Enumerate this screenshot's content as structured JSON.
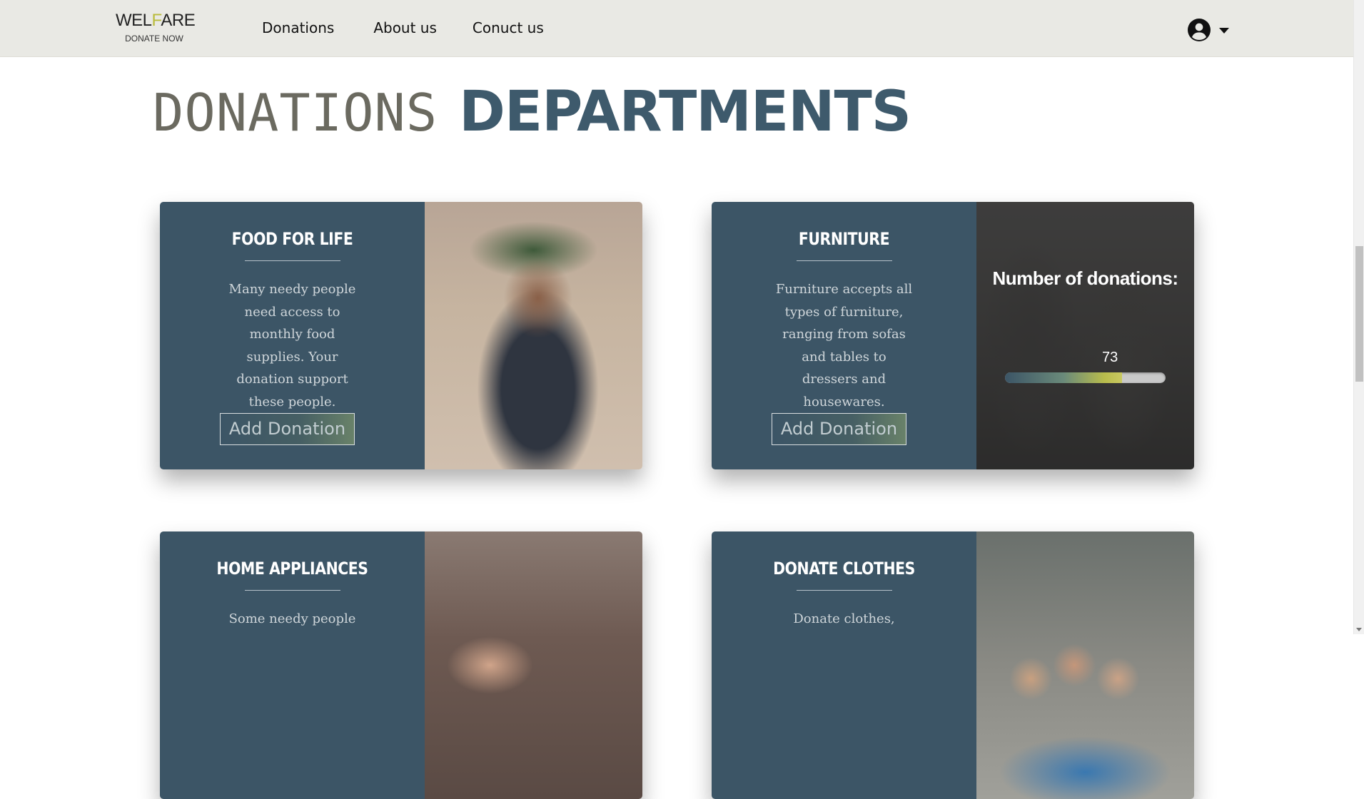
{
  "nav": {
    "brand": {
      "title_prefix": "WEL",
      "title_accent": "F",
      "title_suffix": "ARE",
      "subtitle": "DONATE NOW"
    },
    "links": [
      "Donations",
      "About us",
      "Conuct us"
    ],
    "user_icon": "account-circle-icon",
    "dropdown_icon": "caret-down-icon"
  },
  "heading": {
    "part1": "DONATIONS",
    "part2": "DEPARTMENTS"
  },
  "cards": [
    {
      "title": "FOOD FOR LIFE",
      "description": "Many needy people need access to monthly food supplies. Your donation support these people.",
      "button": "Add Donation"
    },
    {
      "title": "FURNITURE",
      "description": "Furniture accepts all types of furniture, ranging from sofas and tables to dressers and housewares.",
      "button": "Add Donation",
      "overlay": {
        "label": "Number of donations:",
        "count": "73",
        "progress_fraction": 0.73
      }
    },
    {
      "title": "HOME APPLIANCES",
      "description": "Some needy people"
    },
    {
      "title": "DONATE CLOTHES",
      "description": "Donate clothes,"
    }
  ],
  "colors": {
    "navbar_bg": "#e9e9e4",
    "card_bg": "#3c5566",
    "heading_primary": "#6b6a60",
    "heading_accent": "#3e5a6c",
    "brand_accent": "#b9bb3a"
  }
}
